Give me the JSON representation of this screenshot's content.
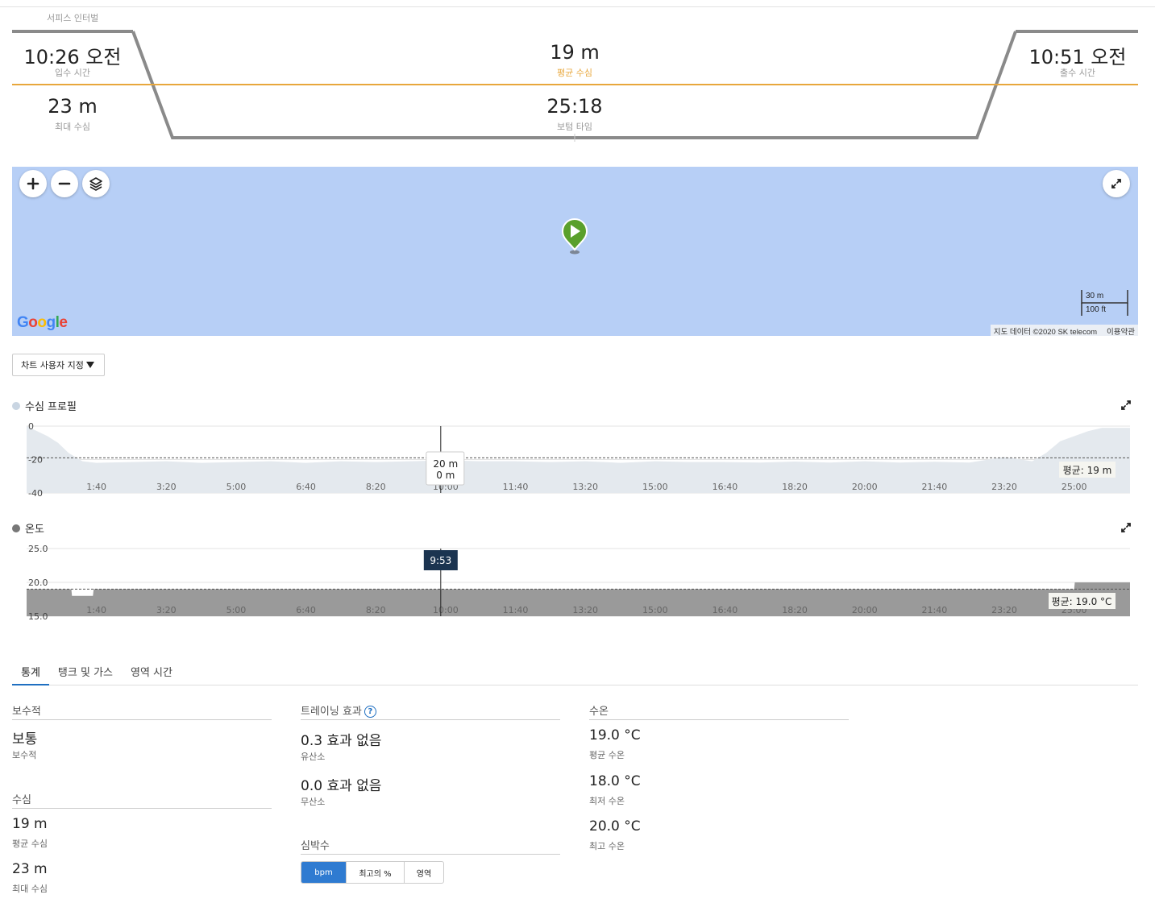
{
  "header": {
    "service_interval": "서피스 인터벌"
  },
  "summary": {
    "entry_time": "10:26 오전",
    "entry_label": "입수 시간",
    "exit_time": "10:51 오전",
    "exit_label": "출수 시간",
    "avg_depth": "19 m",
    "avg_depth_label": "평균 수심",
    "max_depth": "23 m",
    "max_depth_label": "최대 수심",
    "bottom_time": "25:18",
    "bottom_time_label": "보텀 타임",
    "colors": {
      "avg_line": "#e8a73c",
      "profile": "#8a8a8a"
    }
  },
  "map": {
    "background": "#b7cff6",
    "marker_color": "#5aa02c",
    "scale_metric": "30 m",
    "scale_imperial": "100 ft",
    "attribution": "지도 데이터 ©2020 SK telecom",
    "terms": "이용약관",
    "logo_text": "Google",
    "icons": [
      "zoom-in-icon",
      "zoom-out-icon",
      "layers-icon",
      "fullscreen-icon",
      "map-pin-play-icon"
    ]
  },
  "chart_customize": {
    "label": "차트 사용자 지정"
  },
  "chart_data": [
    {
      "type": "area",
      "title": "수심 프로필",
      "legend_color": "#c9d5e2",
      "fill_color": "#e4e9ee",
      "y_ticks": [
        "0",
        "-20",
        "-40"
      ],
      "ylim": [
        0,
        40
      ],
      "y_reversed": true,
      "x_ticks": [
        "1:40",
        "3:20",
        "5:00",
        "6:40",
        "8:20",
        "10:00",
        "11:40",
        "13:20",
        "15:00",
        "16:40",
        "18:20",
        "20:00",
        "21:40",
        "23:20",
        "25:00"
      ],
      "x_tick_values_sec": [
        100,
        200,
        300,
        400,
        500,
        600,
        700,
        800,
        900,
        1000,
        1100,
        1200,
        1300,
        1400,
        1500
      ],
      "xlim_sec": [
        0,
        1580
      ],
      "series": [
        {
          "x_sec": [
            0,
            15,
            30,
            45,
            60,
            80,
            100,
            150,
            200,
            250,
            300,
            350,
            400,
            450,
            500,
            550,
            600,
            650,
            700,
            750,
            800,
            850,
            900,
            950,
            1000,
            1050,
            1100,
            1150,
            1200,
            1250,
            1300,
            1350,
            1400,
            1440,
            1460,
            1480,
            1500,
            1520,
            1540,
            1560,
            1580
          ],
          "depth_m": [
            0,
            3,
            6,
            10,
            16,
            21,
            22,
            21.5,
            21,
            22,
            21.5,
            21,
            22,
            21,
            21.5,
            21,
            20.5,
            21,
            21,
            21.5,
            21,
            22,
            21,
            21.5,
            21.5,
            21.8,
            21.2,
            21.8,
            21,
            21.8,
            21.3,
            21.8,
            18.5,
            21,
            16,
            9,
            6,
            3,
            1,
            1,
            1
          ]
        }
      ],
      "average_label": "평균: 19 m",
      "average_value": 19,
      "tooltip": {
        "line1": "20 m",
        "line2": "0 m",
        "time_sec": 593
      }
    },
    {
      "type": "area",
      "title": "온도",
      "legend_color": "#777777",
      "fill_color": "#9a9a9a",
      "y_ticks": [
        "25.0",
        "20.0",
        "15.0"
      ],
      "ylim": [
        15,
        25
      ],
      "x_ticks": [
        "1:40",
        "3:20",
        "5:00",
        "6:40",
        "8:20",
        "10:00",
        "11:40",
        "13:20",
        "15:00",
        "16:40",
        "18:20",
        "20:00",
        "21:40",
        "23:20",
        "25:00"
      ],
      "x_tick_values_sec": [
        100,
        200,
        300,
        400,
        500,
        600,
        700,
        800,
        900,
        1000,
        1100,
        1200,
        1300,
        1400,
        1500
      ],
      "xlim_sec": [
        0,
        1580
      ],
      "series": [
        {
          "x_sec": [
            0,
            64,
            65,
            95,
            96,
            1500,
            1501,
            1580
          ],
          "temp_c": [
            19,
            19,
            18,
            18,
            19,
            19,
            20,
            20
          ]
        }
      ],
      "average_label": "평균: 19.0 °C",
      "average_value": 19.0,
      "cursor_label": "9:53",
      "cursor_time_sec": 593
    }
  ],
  "tabs": [
    {
      "label": "통계",
      "active": true
    },
    {
      "label": "탱크 및 가스",
      "active": false
    },
    {
      "label": "영역 시간",
      "active": false
    }
  ],
  "stats": {
    "conservatism": {
      "header": "보수적",
      "value": "보통",
      "label": "보수적"
    },
    "depth": {
      "header": "수심",
      "avg_value": "19 m",
      "avg_label": "평균 수심",
      "max_value": "23 m",
      "max_label": "최대 수심"
    },
    "training_effect": {
      "header": "트레이닝 효과",
      "aerobic_value": "0.3 효과 없음",
      "aerobic_label": "유산소",
      "anaerobic_value": "0.0 효과 없음",
      "anaerobic_label": "무산소"
    },
    "heart_rate": {
      "header": "심박수",
      "options": [
        "bpm",
        "최고의 %",
        "영역"
      ],
      "selected": "bpm"
    },
    "water_temp": {
      "header": "수온",
      "avg_value": "19.0 °C",
      "avg_label": "평균 수온",
      "min_value": "18.0 °C",
      "min_label": "최저 수온",
      "max_value": "20.0 °C",
      "max_label": "최고 수온"
    }
  }
}
